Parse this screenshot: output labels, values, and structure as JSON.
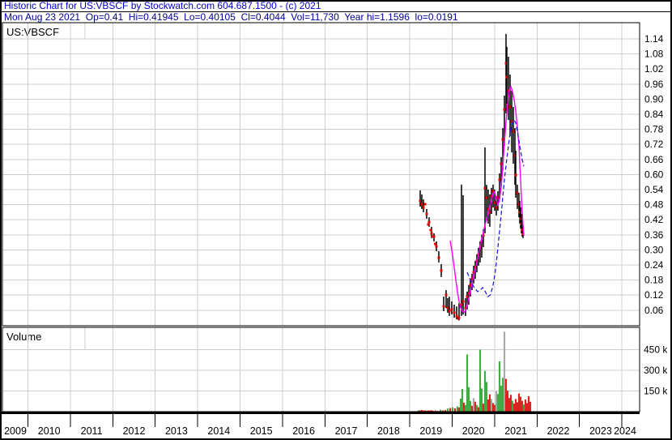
{
  "header": {
    "title": "Historic Chart for US:VBSCF by Stockwatch.com 604.687.1500 - (c) 2021",
    "info": "Mon Aug 23 2021  Op=0.41  Hi=0.41945  Lo=0.40105  Cl=0.4044  Vol=11,730  Year hi=1.1596  lo=0.0191"
  },
  "chart_data": {
    "type": "candlestick",
    "symbol_label": "US:VBSCF",
    "volume_label": "Volume",
    "x_axis": {
      "years": [
        "2009",
        "2010",
        "2011",
        "2012",
        "2013",
        "2014",
        "2015",
        "2016",
        "2017",
        "2018",
        "2019",
        "2020",
        "2021",
        "2022",
        "2023",
        "2024"
      ]
    },
    "price_axis": {
      "step": 0.06,
      "ticks": [
        1.14,
        1.08,
        1.02,
        0.96,
        0.9,
        0.84,
        0.78,
        0.72,
        0.66,
        0.6,
        0.54,
        0.48,
        0.42,
        0.36,
        0.3,
        0.24,
        0.18,
        0.12,
        0.06
      ]
    },
    "volume_axis": {
      "unit": "thousands",
      "ticks": [
        {
          "label": "450 k",
          "value": 450
        },
        {
          "label": "300 k",
          "value": 300
        },
        {
          "label": "150 k",
          "value": 150
        }
      ]
    },
    "series": {
      "daily_bars_hlc": [
        [
          2019.246,
          0.537,
          0.472,
          0.495
        ],
        [
          2019.284,
          0.521,
          0.463,
          0.482
        ],
        [
          2019.323,
          0.501,
          0.45,
          0.469
        ],
        [
          2019.399,
          0.463,
          0.424,
          0.443
        ],
        [
          2019.456,
          0.43,
          0.392,
          0.411
        ],
        [
          2019.514,
          0.392,
          0.347,
          0.366
        ],
        [
          2019.571,
          0.366,
          0.334,
          0.353
        ],
        [
          2019.628,
          0.334,
          0.295,
          0.314
        ],
        [
          2019.685,
          0.295,
          0.25,
          0.269
        ],
        [
          2019.742,
          0.243,
          0.192,
          0.218
        ],
        [
          2019.8,
          0.114,
          0.056,
          0.075
        ],
        [
          2019.857,
          0.14,
          0.069,
          0.121
        ],
        [
          2019.895,
          0.108,
          0.05,
          0.069
        ],
        [
          2019.933,
          0.114,
          0.037,
          0.056
        ],
        [
          2019.99,
          0.095,
          0.043,
          0.063
        ],
        [
          2020.048,
          0.082,
          0.03,
          0.05
        ],
        [
          2020.105,
          0.075,
          0.024,
          0.037
        ],
        [
          2020.162,
          0.088,
          0.019,
          0.03
        ],
        [
          2020.219,
          0.56,
          0.037,
          0.082
        ],
        [
          2020.258,
          0.518,
          0.043,
          0.095
        ],
        [
          2020.315,
          0.108,
          0.037,
          0.069
        ],
        [
          2020.353,
          0.134,
          0.063,
          0.114
        ],
        [
          2020.391,
          0.16,
          0.082,
          0.127
        ],
        [
          2020.429,
          0.185,
          0.114,
          0.16
        ],
        [
          2020.468,
          0.205,
          0.14,
          0.185
        ],
        [
          2020.506,
          0.237,
          0.166,
          0.211
        ],
        [
          2020.544,
          0.256,
          0.185,
          0.231
        ],
        [
          2020.582,
          0.282,
          0.211,
          0.256
        ],
        [
          2020.62,
          0.308,
          0.237,
          0.282
        ],
        [
          2020.658,
          0.334,
          0.25,
          0.308
        ],
        [
          2020.697,
          0.36,
          0.269,
          0.334
        ],
        [
          2020.735,
          0.382,
          0.311,
          0.357
        ],
        [
          2020.773,
          0.708,
          0.366,
          0.546
        ],
        [
          2020.811,
          0.559,
          0.417,
          0.508
        ],
        [
          2020.849,
          0.54,
          0.405,
          0.463
        ],
        [
          2020.887,
          0.521,
          0.392,
          0.45
        ],
        [
          2020.926,
          0.547,
          0.443,
          0.514
        ],
        [
          2020.964,
          0.56,
          0.469,
          0.534
        ],
        [
          2021.002,
          0.54,
          0.456,
          0.488
        ],
        [
          2021.04,
          0.514,
          0.437,
          0.469
        ],
        [
          2021.078,
          0.534,
          0.456,
          0.508
        ],
        [
          2021.117,
          0.605,
          0.502,
          0.579
        ],
        [
          2021.155,
          0.669,
          0.553,
          0.643
        ],
        [
          2021.193,
          0.785,
          0.617,
          0.74
        ],
        [
          2021.231,
          0.914,
          0.714,
          0.859
        ],
        [
          2021.269,
          1.16,
          0.843,
          1.043
        ],
        [
          2021.288,
          1.108,
          0.882,
          0.988
        ],
        [
          2021.326,
          1.069,
          0.817,
          0.934
        ],
        [
          2021.365,
          0.998,
          0.753,
          0.869
        ],
        [
          2021.403,
          0.934,
          0.688,
          0.811
        ],
        [
          2021.441,
          0.869,
          0.643,
          0.772
        ],
        [
          2021.479,
          0.785,
          0.559,
          0.675
        ],
        [
          2021.498,
          0.695,
          0.508,
          0.598
        ],
        [
          2021.536,
          0.56,
          0.463,
          0.527
        ],
        [
          2021.574,
          0.527,
          0.43,
          0.482
        ],
        [
          2021.593,
          0.495,
          0.405,
          0.45
        ],
        [
          2021.613,
          0.469,
          0.385,
          0.424
        ],
        [
          2021.632,
          0.443,
          0.366,
          0.404
        ],
        [
          2021.651,
          0.417,
          0.353,
          0.379
        ],
        [
          2021.67,
          0.398,
          0.347,
          0.363
        ]
      ],
      "extra_close_dots": [
        [
          2019.361,
          0.482
        ],
        [
          2019.437,
          0.401
        ],
        [
          2019.494,
          0.379
        ],
        [
          2019.542,
          0.353
        ],
        [
          2019.599,
          0.324
        ],
        [
          2020.143,
          0.027
        ]
      ],
      "ma_magenta": [
        [
          2019.952,
          0.337
        ],
        [
          2020.01,
          0.279
        ],
        [
          2020.067,
          0.205
        ],
        [
          2020.124,
          0.134
        ],
        [
          2020.162,
          0.095
        ],
        [
          2020.2,
          0.069
        ],
        [
          2020.239,
          0.056
        ],
        [
          2020.296,
          0.053
        ],
        [
          2020.334,
          0.066
        ],
        [
          2020.372,
          0.092
        ],
        [
          2020.41,
          0.124
        ],
        [
          2020.468,
          0.166
        ],
        [
          2020.525,
          0.211
        ],
        [
          2020.582,
          0.253
        ],
        [
          2020.639,
          0.298
        ],
        [
          2020.697,
          0.343
        ],
        [
          2020.754,
          0.385
        ],
        [
          2020.811,
          0.424
        ],
        [
          2020.868,
          0.459
        ],
        [
          2020.926,
          0.495
        ],
        [
          2020.964,
          0.524
        ],
        [
          2021.002,
          0.533
        ],
        [
          2021.04,
          0.501
        ],
        [
          2021.078,
          0.479
        ],
        [
          2021.117,
          0.501
        ],
        [
          2021.155,
          0.55
        ],
        [
          2021.193,
          0.63
        ],
        [
          2021.231,
          0.727
        ],
        [
          2021.269,
          0.811
        ],
        [
          2021.307,
          0.882
        ],
        [
          2021.345,
          0.93
        ],
        [
          2021.384,
          0.95
        ],
        [
          2021.422,
          0.93
        ],
        [
          2021.46,
          0.898
        ],
        [
          2021.498,
          0.853
        ],
        [
          2021.536,
          0.788
        ],
        [
          2021.574,
          0.714
        ],
        [
          2021.593,
          0.643
        ],
        [
          2021.613,
          0.578
        ],
        [
          2021.632,
          0.511
        ],
        [
          2021.651,
          0.45
        ],
        [
          2021.67,
          0.398
        ],
        [
          2021.689,
          0.356
        ]
      ],
      "ma_blue_dashed": [
        [
          2020.353,
          0.211
        ],
        [
          2020.44,
          0.176
        ],
        [
          2020.52,
          0.15
        ],
        [
          2020.6,
          0.134
        ],
        [
          2020.66,
          0.14
        ],
        [
          2020.72,
          0.15
        ],
        [
          2020.78,
          0.134
        ],
        [
          2020.84,
          0.114
        ],
        [
          2020.9,
          0.121
        ],
        [
          2020.96,
          0.156
        ],
        [
          2021.002,
          0.198
        ],
        [
          2021.04,
          0.247
        ],
        [
          2021.078,
          0.311
        ],
        [
          2021.117,
          0.376
        ],
        [
          2021.155,
          0.44
        ],
        [
          2021.193,
          0.511
        ],
        [
          2021.231,
          0.579
        ],
        [
          2021.269,
          0.637
        ],
        [
          2021.307,
          0.689
        ],
        [
          2021.345,
          0.74
        ],
        [
          2021.384,
          0.785
        ],
        [
          2021.422,
          0.808
        ],
        [
          2021.46,
          0.818
        ],
        [
          2021.498,
          0.805
        ],
        [
          2021.536,
          0.772
        ],
        [
          2021.574,
          0.734
        ],
        [
          2021.613,
          0.695
        ],
        [
          2021.651,
          0.659
        ],
        [
          2021.689,
          0.633
        ]
      ],
      "volume_bars": [
        [
          2019.209,
          8,
          "r"
        ],
        [
          2019.246,
          10,
          "g"
        ],
        [
          2019.284,
          12,
          "r"
        ],
        [
          2019.323,
          8,
          "r"
        ],
        [
          2019.361,
          9,
          "r"
        ],
        [
          2019.399,
          7,
          "g"
        ],
        [
          2019.437,
          9,
          "r"
        ],
        [
          2019.475,
          8,
          "r"
        ],
        [
          2019.514,
          10,
          "r"
        ],
        [
          2019.552,
          6,
          "r"
        ],
        [
          2019.609,
          8,
          "r"
        ],
        [
          2019.666,
          6,
          "r"
        ],
        [
          2019.724,
          14,
          "g"
        ],
        [
          2019.781,
          9,
          "r"
        ],
        [
          2019.838,
          11,
          "r"
        ],
        [
          2019.895,
          22,
          "g"
        ],
        [
          2019.952,
          26,
          "r"
        ],
        [
          2020.01,
          32,
          "g"
        ],
        [
          2020.067,
          24,
          "r"
        ],
        [
          2020.124,
          38,
          "g"
        ],
        [
          2020.162,
          30,
          "r"
        ],
        [
          2020.2,
          95,
          "g"
        ],
        [
          2020.239,
          165,
          "g"
        ],
        [
          2020.277,
          65,
          "r"
        ],
        [
          2020.315,
          48,
          "g"
        ],
        [
          2020.353,
          415,
          "g"
        ],
        [
          2020.391,
          178,
          "g"
        ],
        [
          2020.429,
          78,
          "g"
        ],
        [
          2020.468,
          42,
          "r"
        ],
        [
          2020.506,
          98,
          "y"
        ],
        [
          2020.544,
          72,
          "r"
        ],
        [
          2020.582,
          48,
          "g"
        ],
        [
          2020.62,
          32,
          "r"
        ],
        [
          2020.658,
          450,
          "g"
        ],
        [
          2020.697,
          168,
          "g"
        ],
        [
          2020.735,
          58,
          "r"
        ],
        [
          2020.773,
          295,
          "g"
        ],
        [
          2020.811,
          215,
          "g"
        ],
        [
          2020.849,
          88,
          "r"
        ],
        [
          2020.887,
          125,
          "r"
        ],
        [
          2020.926,
          92,
          "y"
        ],
        [
          2020.964,
          62,
          "r"
        ],
        [
          2021.002,
          48,
          "r"
        ],
        [
          2021.04,
          148,
          "y"
        ],
        [
          2021.078,
          128,
          "g"
        ],
        [
          2021.117,
          365,
          "g"
        ],
        [
          2021.155,
          188,
          "g"
        ],
        [
          2021.193,
          245,
          "g"
        ],
        [
          2021.231,
          580,
          "y"
        ],
        [
          2021.269,
          238,
          "r"
        ],
        [
          2021.307,
          152,
          "r"
        ],
        [
          2021.345,
          98,
          "r"
        ],
        [
          2021.384,
          122,
          "r"
        ],
        [
          2021.422,
          78,
          "g"
        ],
        [
          2021.46,
          58,
          "r"
        ],
        [
          2021.498,
          92,
          "r"
        ],
        [
          2021.536,
          68,
          "r"
        ],
        [
          2021.574,
          132,
          "r"
        ],
        [
          2021.613,
          108,
          "r"
        ],
        [
          2021.651,
          78,
          "r"
        ],
        [
          2021.689,
          52,
          "g"
        ],
        [
          2021.727,
          88,
          "r"
        ],
        [
          2021.765,
          62,
          "r"
        ],
        [
          2021.803,
          112,
          "r"
        ],
        [
          2021.841,
          72,
          "r"
        ]
      ]
    },
    "colors": {
      "bar": "#000000",
      "close_dot": "#e10000",
      "ma_magenta": "#ff00ff",
      "ma_blue": "#2222dd",
      "vol_up": "#44aa44",
      "vol_down": "#dd2222",
      "vol_neutral": "#a8a8a8",
      "grid": "#cdcdcd",
      "title_blue": "#0000cc",
      "info_navy": "#000099"
    }
  }
}
